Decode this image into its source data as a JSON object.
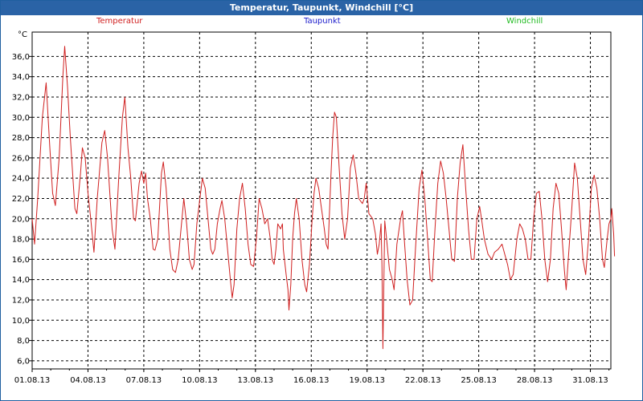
{
  "window_title": "Temperatur, Taupunkt, Windchill [°C]",
  "legend": [
    {
      "label": "Temperatur",
      "color": "#d02020"
    },
    {
      "label": "Taupunkt",
      "color": "#1c1ccc"
    },
    {
      "label": "Windchill",
      "color": "#22bb22"
    }
  ],
  "chart_data": {
    "type": "line",
    "title": "Temperatur, Taupunkt, Windchill [°C]",
    "ylabel": "°C",
    "ylim": [
      5.2,
      38.4
    ],
    "yticks": [
      "6,0",
      "8,0",
      "10,0",
      "12,0",
      "14,0",
      "16,0",
      "18,0",
      "20,0",
      "22,0",
      "24,0",
      "26,0",
      "28,0",
      "30,0",
      "32,0",
      "34,0",
      "36,0"
    ],
    "xlim": [
      0,
      31.1
    ],
    "xticks": [
      {
        "day": 0,
        "label": "01.08.13"
      },
      {
        "day": 3,
        "label": "04.08.13"
      },
      {
        "day": 6,
        "label": "07.08.13"
      },
      {
        "day": 9,
        "label": "10.08.13"
      },
      {
        "day": 12,
        "label": "13.08.13"
      },
      {
        "day": 15,
        "label": "16.08.13"
      },
      {
        "day": 18,
        "label": "19.08.13"
      },
      {
        "day": 21,
        "label": "22.08.13"
      },
      {
        "day": 24,
        "label": "25.08.13"
      },
      {
        "day": 27,
        "label": "28.08.13"
      },
      {
        "day": 30,
        "label": "31.08.13"
      }
    ],
    "grid": true,
    "series": [
      {
        "name": "Temperatur",
        "color": "#d02020",
        "points": [
          [
            0.0,
            20.0
          ],
          [
            0.13,
            17.5
          ],
          [
            0.3,
            22.0
          ],
          [
            0.55,
            30.0
          ],
          [
            0.75,
            33.4
          ],
          [
            0.95,
            27.0
          ],
          [
            1.1,
            22.5
          ],
          [
            1.25,
            21.3
          ],
          [
            1.45,
            26.0
          ],
          [
            1.65,
            34.0
          ],
          [
            1.75,
            37.0
          ],
          [
            1.9,
            33.0
          ],
          [
            2.05,
            28.0
          ],
          [
            2.3,
            21.0
          ],
          [
            2.4,
            20.5
          ],
          [
            2.6,
            24.5
          ],
          [
            2.7,
            27.0
          ],
          [
            2.85,
            26.0
          ],
          [
            3.0,
            22.5
          ],
          [
            3.15,
            20.0
          ],
          [
            3.32,
            16.7
          ],
          [
            3.5,
            22.0
          ],
          [
            3.75,
            27.5
          ],
          [
            3.9,
            28.7
          ],
          [
            4.05,
            26.0
          ],
          [
            4.3,
            19.0
          ],
          [
            4.45,
            17.0
          ],
          [
            4.65,
            24.0
          ],
          [
            4.85,
            30.0
          ],
          [
            4.98,
            32.0
          ],
          [
            5.15,
            27.0
          ],
          [
            5.3,
            24.0
          ],
          [
            5.45,
            20.0
          ],
          [
            5.55,
            19.8
          ],
          [
            5.75,
            23.5
          ],
          [
            5.88,
            24.7
          ],
          [
            6.0,
            23.5
          ],
          [
            6.1,
            24.5
          ],
          [
            6.2,
            22.0
          ],
          [
            6.35,
            20.0
          ],
          [
            6.5,
            17.0
          ],
          [
            6.6,
            16.9
          ],
          [
            6.75,
            18.0
          ],
          [
            6.95,
            24.5
          ],
          [
            7.05,
            25.6
          ],
          [
            7.2,
            23.0
          ],
          [
            7.4,
            17.0
          ],
          [
            7.55,
            15.0
          ],
          [
            7.7,
            14.7
          ],
          [
            7.85,
            16.0
          ],
          [
            8.05,
            20.0
          ],
          [
            8.15,
            22.0
          ],
          [
            8.3,
            19.5
          ],
          [
            8.45,
            16.0
          ],
          [
            8.6,
            15.0
          ],
          [
            8.7,
            15.5
          ],
          [
            8.85,
            19.5
          ],
          [
            9.05,
            22.5
          ],
          [
            9.15,
            24.0
          ],
          [
            9.3,
            23.0
          ],
          [
            9.45,
            20.0
          ],
          [
            9.6,
            17.0
          ],
          [
            9.7,
            16.5
          ],
          [
            9.82,
            17.0
          ],
          [
            9.95,
            19.5
          ],
          [
            10.1,
            21.0
          ],
          [
            10.2,
            21.8
          ],
          [
            10.35,
            20.0
          ],
          [
            10.5,
            17.0
          ],
          [
            10.65,
            14.0
          ],
          [
            10.75,
            12.2
          ],
          [
            10.85,
            13.5
          ],
          [
            11.0,
            19.0
          ],
          [
            11.15,
            22.0
          ],
          [
            11.3,
            23.5
          ],
          [
            11.45,
            21.0
          ],
          [
            11.6,
            17.5
          ],
          [
            11.75,
            15.5
          ],
          [
            11.9,
            15.3
          ],
          [
            12.05,
            18.0
          ],
          [
            12.2,
            22.0
          ],
          [
            12.35,
            21.0
          ],
          [
            12.5,
            19.5
          ],
          [
            12.65,
            20.0
          ],
          [
            12.8,
            18.0
          ],
          [
            12.9,
            16.0
          ],
          [
            13.0,
            15.5
          ],
          [
            13.1,
            17.0
          ],
          [
            13.2,
            19.5
          ],
          [
            13.35,
            19.0
          ],
          [
            13.45,
            19.5
          ],
          [
            13.5,
            17.0
          ],
          [
            13.65,
            14.5
          ],
          [
            13.75,
            13.0
          ],
          [
            13.8,
            11.0
          ],
          [
            13.9,
            13.5
          ],
          [
            14.0,
            18.0
          ],
          [
            14.1,
            20.5
          ],
          [
            14.2,
            22.0
          ],
          [
            14.35,
            20.0
          ],
          [
            14.5,
            16.0
          ],
          [
            14.65,
            13.5
          ],
          [
            14.75,
            12.8
          ],
          [
            14.9,
            15.5
          ],
          [
            15.05,
            20.0
          ],
          [
            15.15,
            22.5
          ],
          [
            15.25,
            24.0
          ],
          [
            15.4,
            23.0
          ],
          [
            15.55,
            21.0
          ],
          [
            15.7,
            19.0
          ],
          [
            15.8,
            17.5
          ],
          [
            15.9,
            17.0
          ],
          [
            16.05,
            24.0
          ],
          [
            16.15,
            28.0
          ],
          [
            16.25,
            30.5
          ],
          [
            16.35,
            30.0
          ],
          [
            16.5,
            25.0
          ],
          [
            16.65,
            20.5
          ],
          [
            16.8,
            18.0
          ],
          [
            16.95,
            20.0
          ],
          [
            17.1,
            25.0
          ],
          [
            17.25,
            26.3
          ],
          [
            17.4,
            24.5
          ],
          [
            17.55,
            22.0
          ],
          [
            17.75,
            21.5
          ],
          [
            17.85,
            22.0
          ],
          [
            17.95,
            23.5
          ],
          [
            18.1,
            20.5
          ],
          [
            18.3,
            20.0
          ],
          [
            18.45,
            18.5
          ],
          [
            18.55,
            16.5
          ],
          [
            18.65,
            17.5
          ],
          [
            18.75,
            19.5
          ],
          [
            18.8,
            15.5
          ],
          [
            18.85,
            7.2
          ],
          [
            18.95,
            19.8
          ],
          [
            19.05,
            18.0
          ],
          [
            19.2,
            15.0
          ],
          [
            19.35,
            14.0
          ],
          [
            19.45,
            13.0
          ],
          [
            19.6,
            17.5
          ],
          [
            19.8,
            20.0
          ],
          [
            19.9,
            20.8
          ],
          [
            20.0,
            18.0
          ],
          [
            20.15,
            14.0
          ],
          [
            20.3,
            11.5
          ],
          [
            20.45,
            12.0
          ],
          [
            20.6,
            17.0
          ],
          [
            20.8,
            23.0
          ],
          [
            20.95,
            24.8
          ],
          [
            21.1,
            22.0
          ],
          [
            21.25,
            18.0
          ],
          [
            21.4,
            14.0
          ],
          [
            21.5,
            13.8
          ],
          [
            21.65,
            19.0
          ],
          [
            21.8,
            23.5
          ],
          [
            21.95,
            25.7
          ],
          [
            22.1,
            24.5
          ],
          [
            22.25,
            22.0
          ],
          [
            22.4,
            19.0
          ],
          [
            22.55,
            16.0
          ],
          [
            22.7,
            15.8
          ],
          [
            22.85,
            22.0
          ],
          [
            23.0,
            25.5
          ],
          [
            23.15,
            27.3
          ],
          [
            23.3,
            23.0
          ],
          [
            23.45,
            19.0
          ],
          [
            23.6,
            16.0
          ],
          [
            23.75,
            16.0
          ],
          [
            23.9,
            20.0
          ],
          [
            24.05,
            21.2
          ],
          [
            24.15,
            20.0
          ],
          [
            24.3,
            18.0
          ],
          [
            24.5,
            16.5
          ],
          [
            24.7,
            16.0
          ],
          [
            24.85,
            16.7
          ],
          [
            25.05,
            17.0
          ],
          [
            25.25,
            17.5
          ],
          [
            25.4,
            16.5
          ],
          [
            25.55,
            15.5
          ],
          [
            25.7,
            14.0
          ],
          [
            25.85,
            14.5
          ],
          [
            26.05,
            18.0
          ],
          [
            26.2,
            19.5
          ],
          [
            26.35,
            19.0
          ],
          [
            26.5,
            18.0
          ],
          [
            26.65,
            16.0
          ],
          [
            26.8,
            16.0
          ],
          [
            26.95,
            20.0
          ],
          [
            27.1,
            22.5
          ],
          [
            27.25,
            22.7
          ],
          [
            27.4,
            20.0
          ],
          [
            27.55,
            16.0
          ],
          [
            27.7,
            13.8
          ],
          [
            27.85,
            16.0
          ],
          [
            28.0,
            21.0
          ],
          [
            28.15,
            23.5
          ],
          [
            28.3,
            22.5
          ],
          [
            28.45,
            19.0
          ],
          [
            28.6,
            15.0
          ],
          [
            28.7,
            13.0
          ],
          [
            28.85,
            17.0
          ],
          [
            29.0,
            21.0
          ],
          [
            29.15,
            25.5
          ],
          [
            29.3,
            24.0
          ],
          [
            29.45,
            20.0
          ],
          [
            29.6,
            16.0
          ],
          [
            29.75,
            14.5
          ],
          [
            29.9,
            18.0
          ],
          [
            30.05,
            23.0
          ],
          [
            30.2,
            24.3
          ],
          [
            30.35,
            23.0
          ],
          [
            30.5,
            20.0
          ],
          [
            30.65,
            16.0
          ],
          [
            30.75,
            15.2
          ],
          [
            30.9,
            18.0
          ],
          [
            31.0,
            19.5
          ],
          [
            31.1,
            20.0
          ],
          [
            31.15,
            21.0
          ],
          [
            31.25,
            18.5
          ],
          [
            31.3,
            16.3
          ]
        ]
      }
    ]
  }
}
